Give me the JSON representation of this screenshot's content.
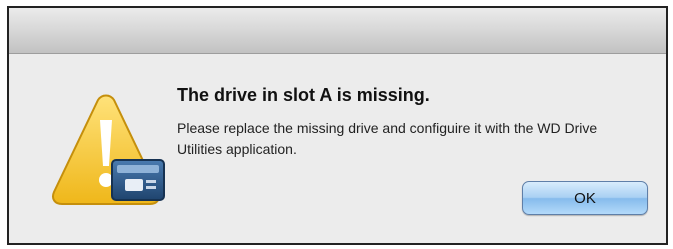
{
  "dialog": {
    "title": "The drive in slot A is missing.",
    "message": "Please replace the missing drive and configuire it with the WD Drive Utilities application.",
    "ok_label": "OK"
  },
  "icons": {
    "alert": "warning-triangle-with-drive-icon"
  },
  "colors": {
    "warning_yellow": "#f3c21b",
    "drive_blue": "#2f5e8e",
    "button_blue": "#9ccaf1"
  }
}
